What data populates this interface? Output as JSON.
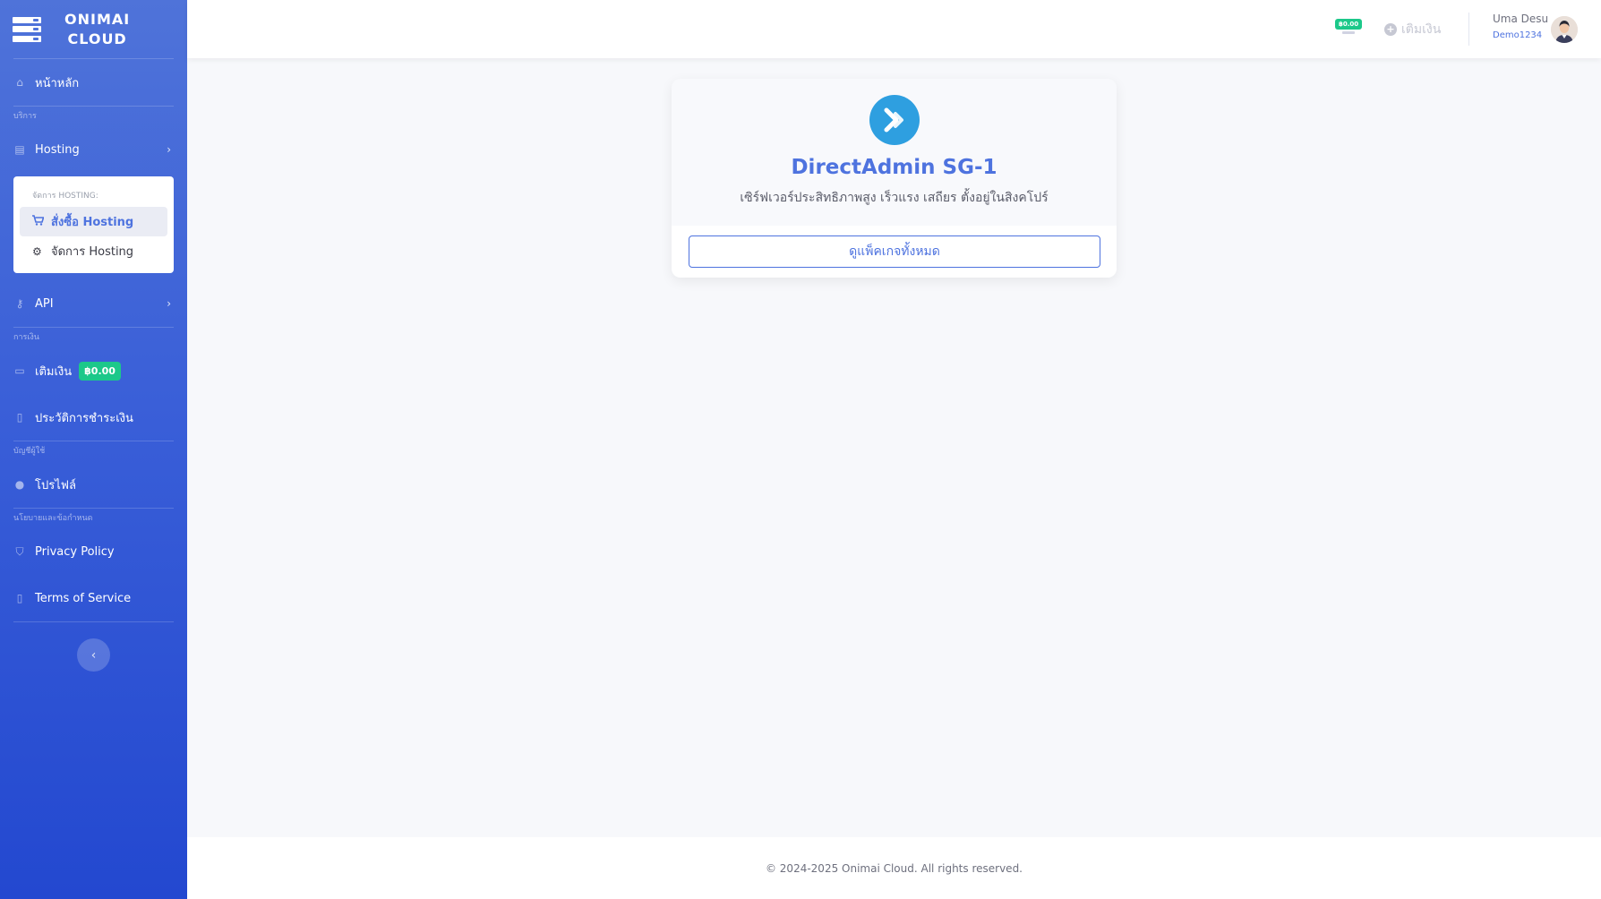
{
  "brand": {
    "line1": "ONIMAI",
    "line2": "CLOUD",
    "icon": "server-icon"
  },
  "sidebar": {
    "home": {
      "label": "หน้าหลัก",
      "icon": "home-icon"
    },
    "section_services": "บริการ",
    "hosting": {
      "label": "Hosting",
      "icon": "server-icon"
    },
    "hosting_submenu": {
      "header": "จัดการ HOSTING:",
      "items": [
        {
          "label": "สั่งซื้อ Hosting",
          "icon": "cart-icon",
          "active": true
        },
        {
          "label": "จัดการ Hosting",
          "icon": "cogs-icon",
          "active": false
        }
      ]
    },
    "api": {
      "label": "API",
      "icon": "key-icon"
    },
    "section_finance": "การเงิน",
    "topup": {
      "label": "เติมเงิน",
      "icon": "wallet-icon",
      "badge": "฿0.00"
    },
    "payment_history": {
      "label": "ประวัติการชำระเงิน",
      "icon": "file-icon"
    },
    "section_account": "บัญชีผู้ใช้",
    "profile": {
      "label": "โปรไฟล์",
      "icon": "user-icon"
    },
    "section_policy": "นโยบายและข้อกำหนด",
    "privacy": {
      "label": "Privacy Policy",
      "icon": "shield-icon"
    },
    "terms": {
      "label": "Terms of Service",
      "icon": "file-icon"
    }
  },
  "topbar": {
    "balance_badge": "฿0.00",
    "topup_label": "เติมเงิน",
    "user_name": "Uma Desu",
    "user_sub": "Demo1234"
  },
  "card": {
    "title": "DirectAdmin SG-1",
    "description": "เซิร์ฟเวอร์ประสิทธิภาพสูง เร็วแรง เสถียร ตั้งอยู่ในสิงคโปร์",
    "button": "ดูแพ็คเกจทั้งหมด"
  },
  "footer": {
    "copyright": "© 2024-2025 Onimai Cloud. All rights reserved."
  },
  "colors": {
    "primary": "#4e73df",
    "success": "#1cc88a",
    "logo": "#2e9fe0"
  }
}
